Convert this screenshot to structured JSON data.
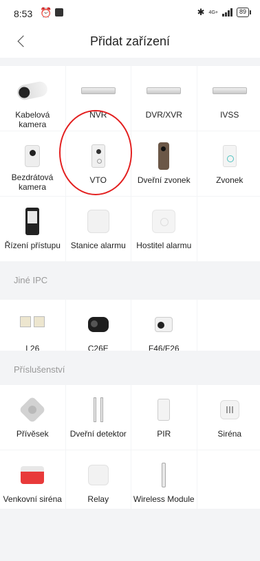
{
  "status_bar": {
    "time": "8:53",
    "network_label": "4G+",
    "battery": "89"
  },
  "nav": {
    "title": "Přidat zařízení"
  },
  "devices": [
    {
      "label": "Kabelová kamera",
      "icon": "wired-camera-icon"
    },
    {
      "label": "NVR",
      "icon": "nvr-icon"
    },
    {
      "label": "DVR/XVR",
      "icon": "dvr-icon"
    },
    {
      "label": "IVSS",
      "icon": "ivss-icon"
    },
    {
      "label": "Bezdrátová kamera",
      "icon": "wireless-camera-icon"
    },
    {
      "label": "VTO",
      "icon": "vto-icon"
    },
    {
      "label": "Dveřní zvonek",
      "icon": "doorbell-icon"
    },
    {
      "label": "Zvonek",
      "icon": "chime-icon"
    },
    {
      "label": "Řízení přístupu",
      "icon": "access-control-icon"
    },
    {
      "label": "Stanice alarmu",
      "icon": "alarm-station-icon"
    },
    {
      "label": "Hostitel alarmu",
      "icon": "alarm-host-icon"
    }
  ],
  "other_ipc": {
    "title": "Jiné IPC",
    "items": [
      {
        "label": "L26",
        "icon": "floodlight-camera-icon"
      },
      {
        "label": "C26E",
        "icon": "bullet-camera-icon"
      },
      {
        "label": "F46/F26",
        "icon": "wifi-camera-icon"
      }
    ]
  },
  "accessories": {
    "title": "Příslušenství",
    "items": [
      {
        "label": "Přívěsek",
        "icon": "pendant-icon"
      },
      {
        "label": "Dveřní detektor",
        "icon": "door-detector-icon"
      },
      {
        "label": "PIR",
        "icon": "pir-sensor-icon"
      },
      {
        "label": "Siréna",
        "icon": "indoor-siren-icon"
      },
      {
        "label": "Venkovní siréna",
        "icon": "outdoor-siren-icon"
      },
      {
        "label": "Relay",
        "icon": "relay-icon"
      },
      {
        "label": "Wireless Module",
        "icon": "wireless-module-icon"
      }
    ]
  },
  "colors": {
    "accent_highlight": "#e32020",
    "section_background": "#f3f4f6"
  }
}
